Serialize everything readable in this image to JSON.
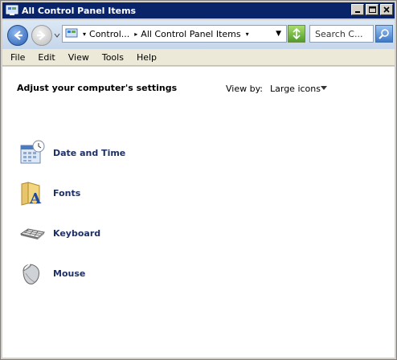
{
  "window": {
    "title": "All Control Panel Items"
  },
  "address": {
    "crumbs": [
      "Control...",
      "All Control Panel Items"
    ],
    "search_placeholder": "Search C..."
  },
  "menu": [
    "File",
    "Edit",
    "View",
    "Tools",
    "Help"
  ],
  "content": {
    "heading": "Adjust your computer's settings",
    "view_by_label": "View by:",
    "view_by_value": "Large icons",
    "items": [
      {
        "label": "Date and Time",
        "icon": "calendar-clock-icon"
      },
      {
        "label": "Fonts",
        "icon": "fonts-folder-icon"
      },
      {
        "label": "Keyboard",
        "icon": "keyboard-icon"
      },
      {
        "label": "Mouse",
        "icon": "mouse-icon"
      }
    ]
  },
  "colors": {
    "titlebar": "#0a246a",
    "link": "#1e3064"
  }
}
